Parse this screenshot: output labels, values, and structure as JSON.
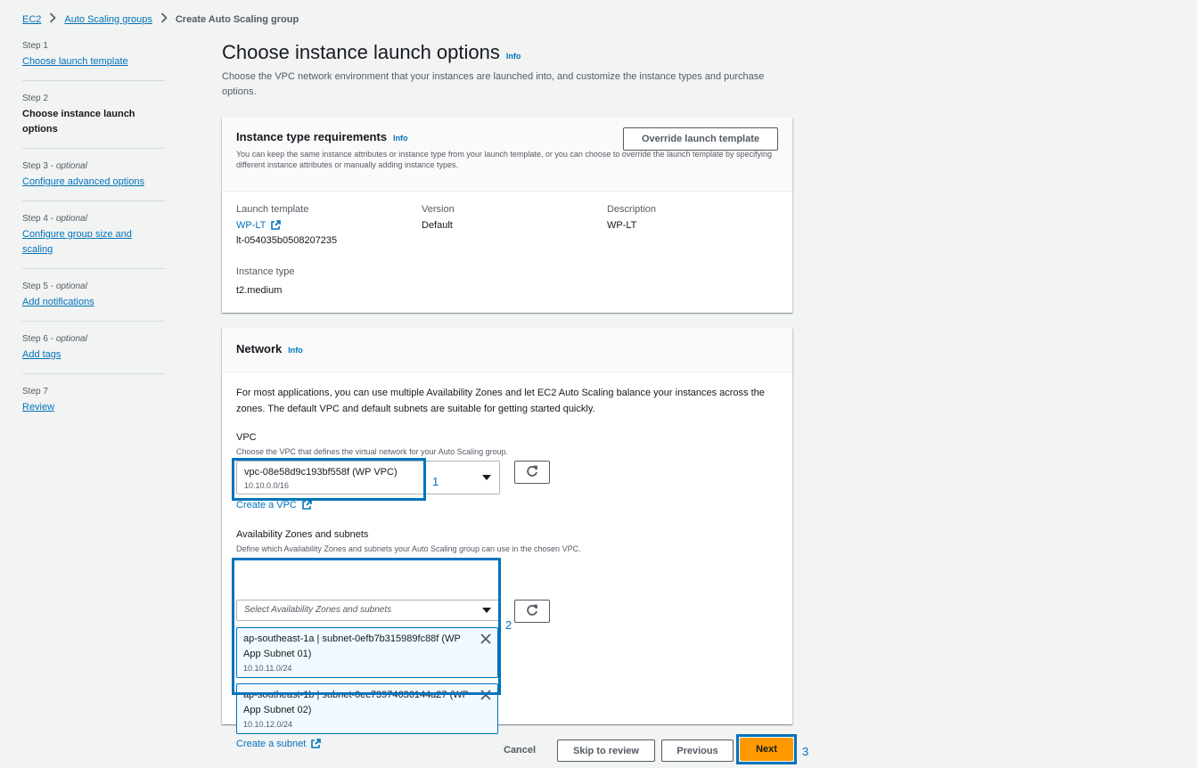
{
  "breadcrumb": {
    "ec2": "EC2",
    "asg": "Auto Scaling groups",
    "current": "Create Auto Scaling group"
  },
  "steps": [
    {
      "label": "Step 1",
      "optional": "",
      "name": "Choose launch template"
    },
    {
      "label": "Step 2",
      "optional": "",
      "name": "Choose instance launch options"
    },
    {
      "label": "Step 3 - ",
      "optional": "optional",
      "name": "Configure advanced options"
    },
    {
      "label": "Step 4 - ",
      "optional": "optional",
      "name": "Configure group size and scaling"
    },
    {
      "label": "Step 5 - ",
      "optional": "optional",
      "name": "Add notifications"
    },
    {
      "label": "Step 6 - ",
      "optional": "optional",
      "name": "Add tags"
    },
    {
      "label": "Step 7",
      "optional": "",
      "name": "Review"
    }
  ],
  "page": {
    "title": "Choose instance launch options",
    "info": "Info",
    "description": "Choose the VPC network environment that your instances are launched into, and customize the instance types and purchase options."
  },
  "instance_req": {
    "title": "Instance type requirements",
    "info": "Info",
    "override_btn": "Override launch template",
    "description": "You can keep the same instance attributes or instance type from your launch template, or you can choose to override the launch template by specifying different instance attributes or manually adding instance types.",
    "launch_template_label": "Launch template",
    "launch_template_name": "WP-LT",
    "launch_template_id": "lt-054035b0508207235",
    "version_label": "Version",
    "version_value": "Default",
    "description_label": "Description",
    "description_value": "WP-LT",
    "instance_type_label": "Instance type",
    "instance_type_value": "t2.medium"
  },
  "network": {
    "title": "Network",
    "info": "Info",
    "intro": "For most applications, you can use multiple Availability Zones and let EC2 Auto Scaling balance your instances across the zones. The default VPC and default subnets are suitable for getting started quickly.",
    "vpc_label": "VPC",
    "vpc_desc": "Choose the VPC that defines the virtual network for your Auto Scaling group.",
    "vpc_value": "vpc-08e58d9c193bf558f (WP VPC)",
    "vpc_cidr": "10.10.0.0/16",
    "create_vpc": "Create a VPC",
    "az_label": "Availability Zones and subnets",
    "az_desc": "Define which Availability Zones and subnets your Auto Scaling group can use in the chosen VPC.",
    "az_placeholder": "Select Availability Zones and subnets",
    "subnets": [
      {
        "name": "ap-southeast-1a | subnet-0efb7b315989fc88f (WP App Subnet 01)",
        "cidr": "10.10.11.0/24"
      },
      {
        "name": "ap-southeast-1b | subnet-0ec73974636144a27 (WP App Subnet 02)",
        "cidr": "10.10.12.0/24"
      }
    ],
    "create_subnet": "Create a subnet"
  },
  "footer": {
    "cancel": "Cancel",
    "skip": "Skip to review",
    "previous": "Previous",
    "next": "Next"
  },
  "annotations": {
    "one": "1",
    "two": "2",
    "three": "3"
  },
  "colors": {
    "accent": "#0073bb",
    "primary": "#ec7211",
    "background": "#f2f3f3"
  }
}
